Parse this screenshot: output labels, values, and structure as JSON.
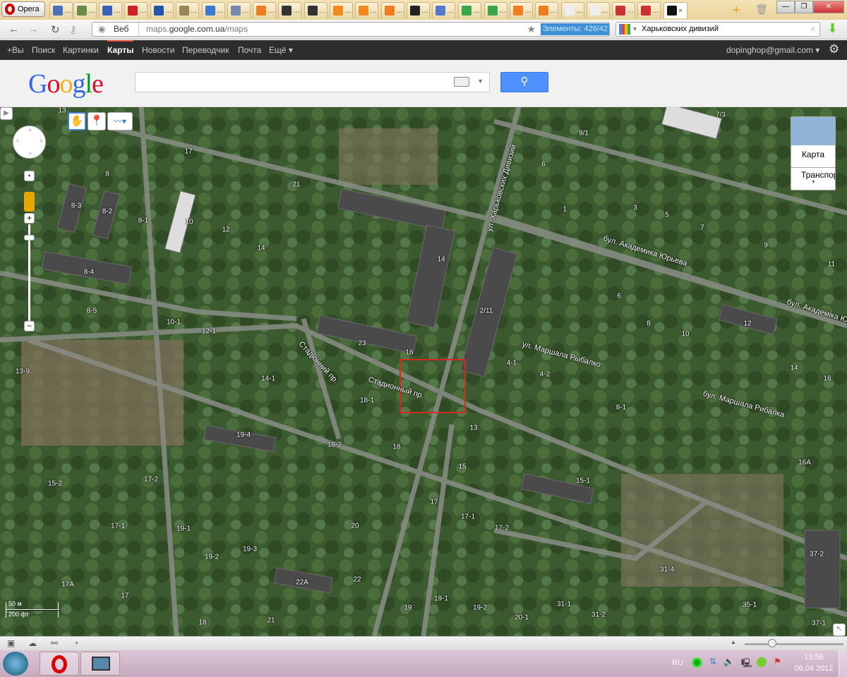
{
  "browser": {
    "menu_label": "Opera",
    "tabs": [
      "…",
      "…",
      "…",
      "…",
      "…",
      "…",
      "…",
      "…",
      "…",
      "…",
      "…",
      "…",
      "…",
      "…",
      "…",
      "…",
      "…",
      "…",
      "…",
      "…",
      "…",
      "…",
      "…",
      "…"
    ],
    "tab_colors": [
      "#4a72b5",
      "#6a8a4a",
      "#3a62b8",
      "#cc2222",
      "#2255aa",
      "#998855",
      "#3a7ad5",
      "#7788aa",
      "#f07d20",
      "#333333",
      "#333333",
      "#f08a20",
      "#f08a20",
      "#f07d20",
      "#222222",
      "#5577cc",
      "#3aa64a",
      "#3aa64a",
      "#f07d20",
      "#f07d20",
      "#eeeeee",
      "#eeeeee",
      "#cc3333",
      "#cc3333",
      "#111111"
    ],
    "address_prefix": "Веб",
    "url_host_pre": "maps.",
    "url_host_bold": "google.com.ua",
    "url_path": "/maps",
    "elements_counter": "Элементы:  426/42",
    "search_value": "Харьковских дивизий"
  },
  "google_bar": {
    "items": [
      "+Вы",
      "Поиск",
      "Картинки",
      "Карты",
      "Новости",
      "Переводчик",
      "Почта",
      "Ещё ▾"
    ],
    "account": "dopinghop@gmail.com ▾"
  },
  "header": {
    "logo": "Google",
    "search_placeholder": ""
  },
  "map": {
    "map_type_label": "Карта",
    "layer_label": "Транспор",
    "scale_metric": "50 м",
    "scale_imperial": "200 фт",
    "streets": [
      "ул. Харьковских Дивизий",
      "бул. Академика Юрьева",
      "бул. Академіка Юр'єва",
      "ул. Маршала Рыбалко",
      "бул. Маршала Рибалка",
      "Стадионный пр.",
      "Стадіонний пр."
    ],
    "buildings": [
      "13",
      "17",
      "8",
      "8-3",
      "8-2",
      "8-1",
      "10",
      "12",
      "21",
      "14",
      "8-4",
      "8-5",
      "10-1",
      "12-1",
      "13-9",
      "14",
      "23",
      "16",
      "14-1",
      "18-1",
      "18-2",
      "18",
      "19-4",
      "13",
      "15",
      "15-2",
      "17-2",
      "17-1",
      "19-1",
      "19-2",
      "19-3",
      "20",
      "17",
      "17-1",
      "17-2",
      "22А",
      "22",
      "17А",
      "17",
      "18",
      "21",
      "19",
      "19-1",
      "19-2",
      "20-1",
      "31-1",
      "31-2",
      "31-4",
      "35-1",
      "37-2",
      "37-1",
      "16А",
      "15-1",
      "8-1",
      "4-1",
      "4-2",
      "2/11",
      "14",
      "16",
      "10",
      "12",
      "8",
      "6",
      "11",
      "9",
      "7",
      "5",
      "3",
      "1",
      "6",
      "9/1",
      "7/3"
    ]
  },
  "taskbar": {
    "lang": "RU",
    "time": "15:56",
    "date": "06.04.2012"
  }
}
